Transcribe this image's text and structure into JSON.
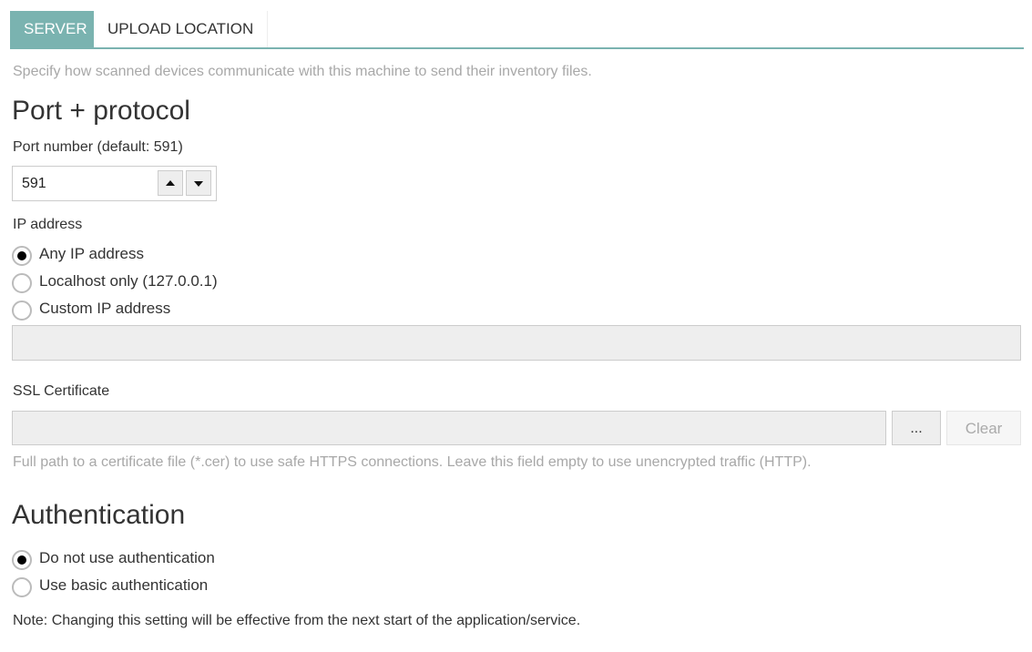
{
  "tabs": [
    {
      "label": "SERVER",
      "active": true
    },
    {
      "label": "UPLOAD LOCATION",
      "active": false
    }
  ],
  "description": "Specify how scanned devices communicate with this machine to send their inventory files.",
  "port_section": {
    "title": "Port + protocol",
    "port_label": "Port number (default: 591)",
    "port_value": "591",
    "ip_label": "IP address",
    "ip_options": [
      {
        "label": "Any IP address",
        "selected": true
      },
      {
        "label": "Localhost only (127.0.0.1)",
        "selected": false
      },
      {
        "label": "Custom IP address",
        "selected": false
      }
    ],
    "custom_ip_value": ""
  },
  "ssl": {
    "label": "SSL Certificate",
    "value": "",
    "browse_label": "...",
    "clear_label": "Clear",
    "hint": "Full path to a certificate file (*.cer) to use safe HTTPS connections. Leave this field empty to use unencrypted traffic (HTTP)."
  },
  "auth": {
    "title": "Authentication",
    "options": [
      {
        "label": "Do not use authentication",
        "selected": true
      },
      {
        "label": "Use basic authentication",
        "selected": false
      }
    ],
    "note": "Note: Changing this setting will be effective from the next start of the application/service."
  },
  "colors": {
    "accent": "#7ab3b0"
  }
}
